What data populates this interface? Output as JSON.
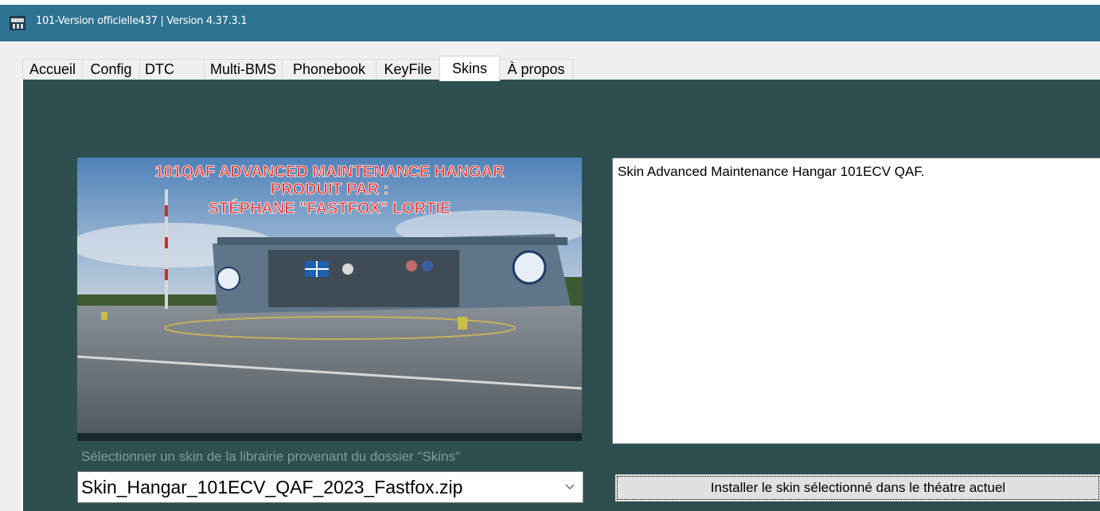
{
  "window": {
    "title": "101-Version officielle437 | Version 4.37.3.1",
    "icon": "app-logo-icon"
  },
  "tabs": [
    {
      "label": "Accueil",
      "active": false
    },
    {
      "label": "Config",
      "active": false
    },
    {
      "label": "DTC",
      "active": false
    },
    {
      "label": "Multi-BMS",
      "active": false
    },
    {
      "label": "Phonebook",
      "active": false
    },
    {
      "label": "KeyFile",
      "active": false
    },
    {
      "label": "Skins",
      "active": true
    },
    {
      "label": "À propos",
      "active": false
    }
  ],
  "skins": {
    "preview": {
      "banner_line1": "101QAF ADVANCED MAINTENANCE HANGAR",
      "banner_line2": "PRODUIT PAR :",
      "banner_line3": "STÉPHANE \"FASTFOX\" LORTIE",
      "banner_color": "#e8322a"
    },
    "description": "Skin Advanced Maintenance Hangar 101ECV QAF.",
    "select_hint": "Sélectionner un skin de la librairie provenant du dossier \"Skins\"",
    "selected_skin": "Skin_Hangar_101ECV_QAF_2023_Fastfox.zip",
    "install_label": "Installer le skin sélectionné dans le théatre actuel"
  },
  "colors": {
    "titlebar": "#2e7391",
    "panel": "#2e4f4f"
  }
}
